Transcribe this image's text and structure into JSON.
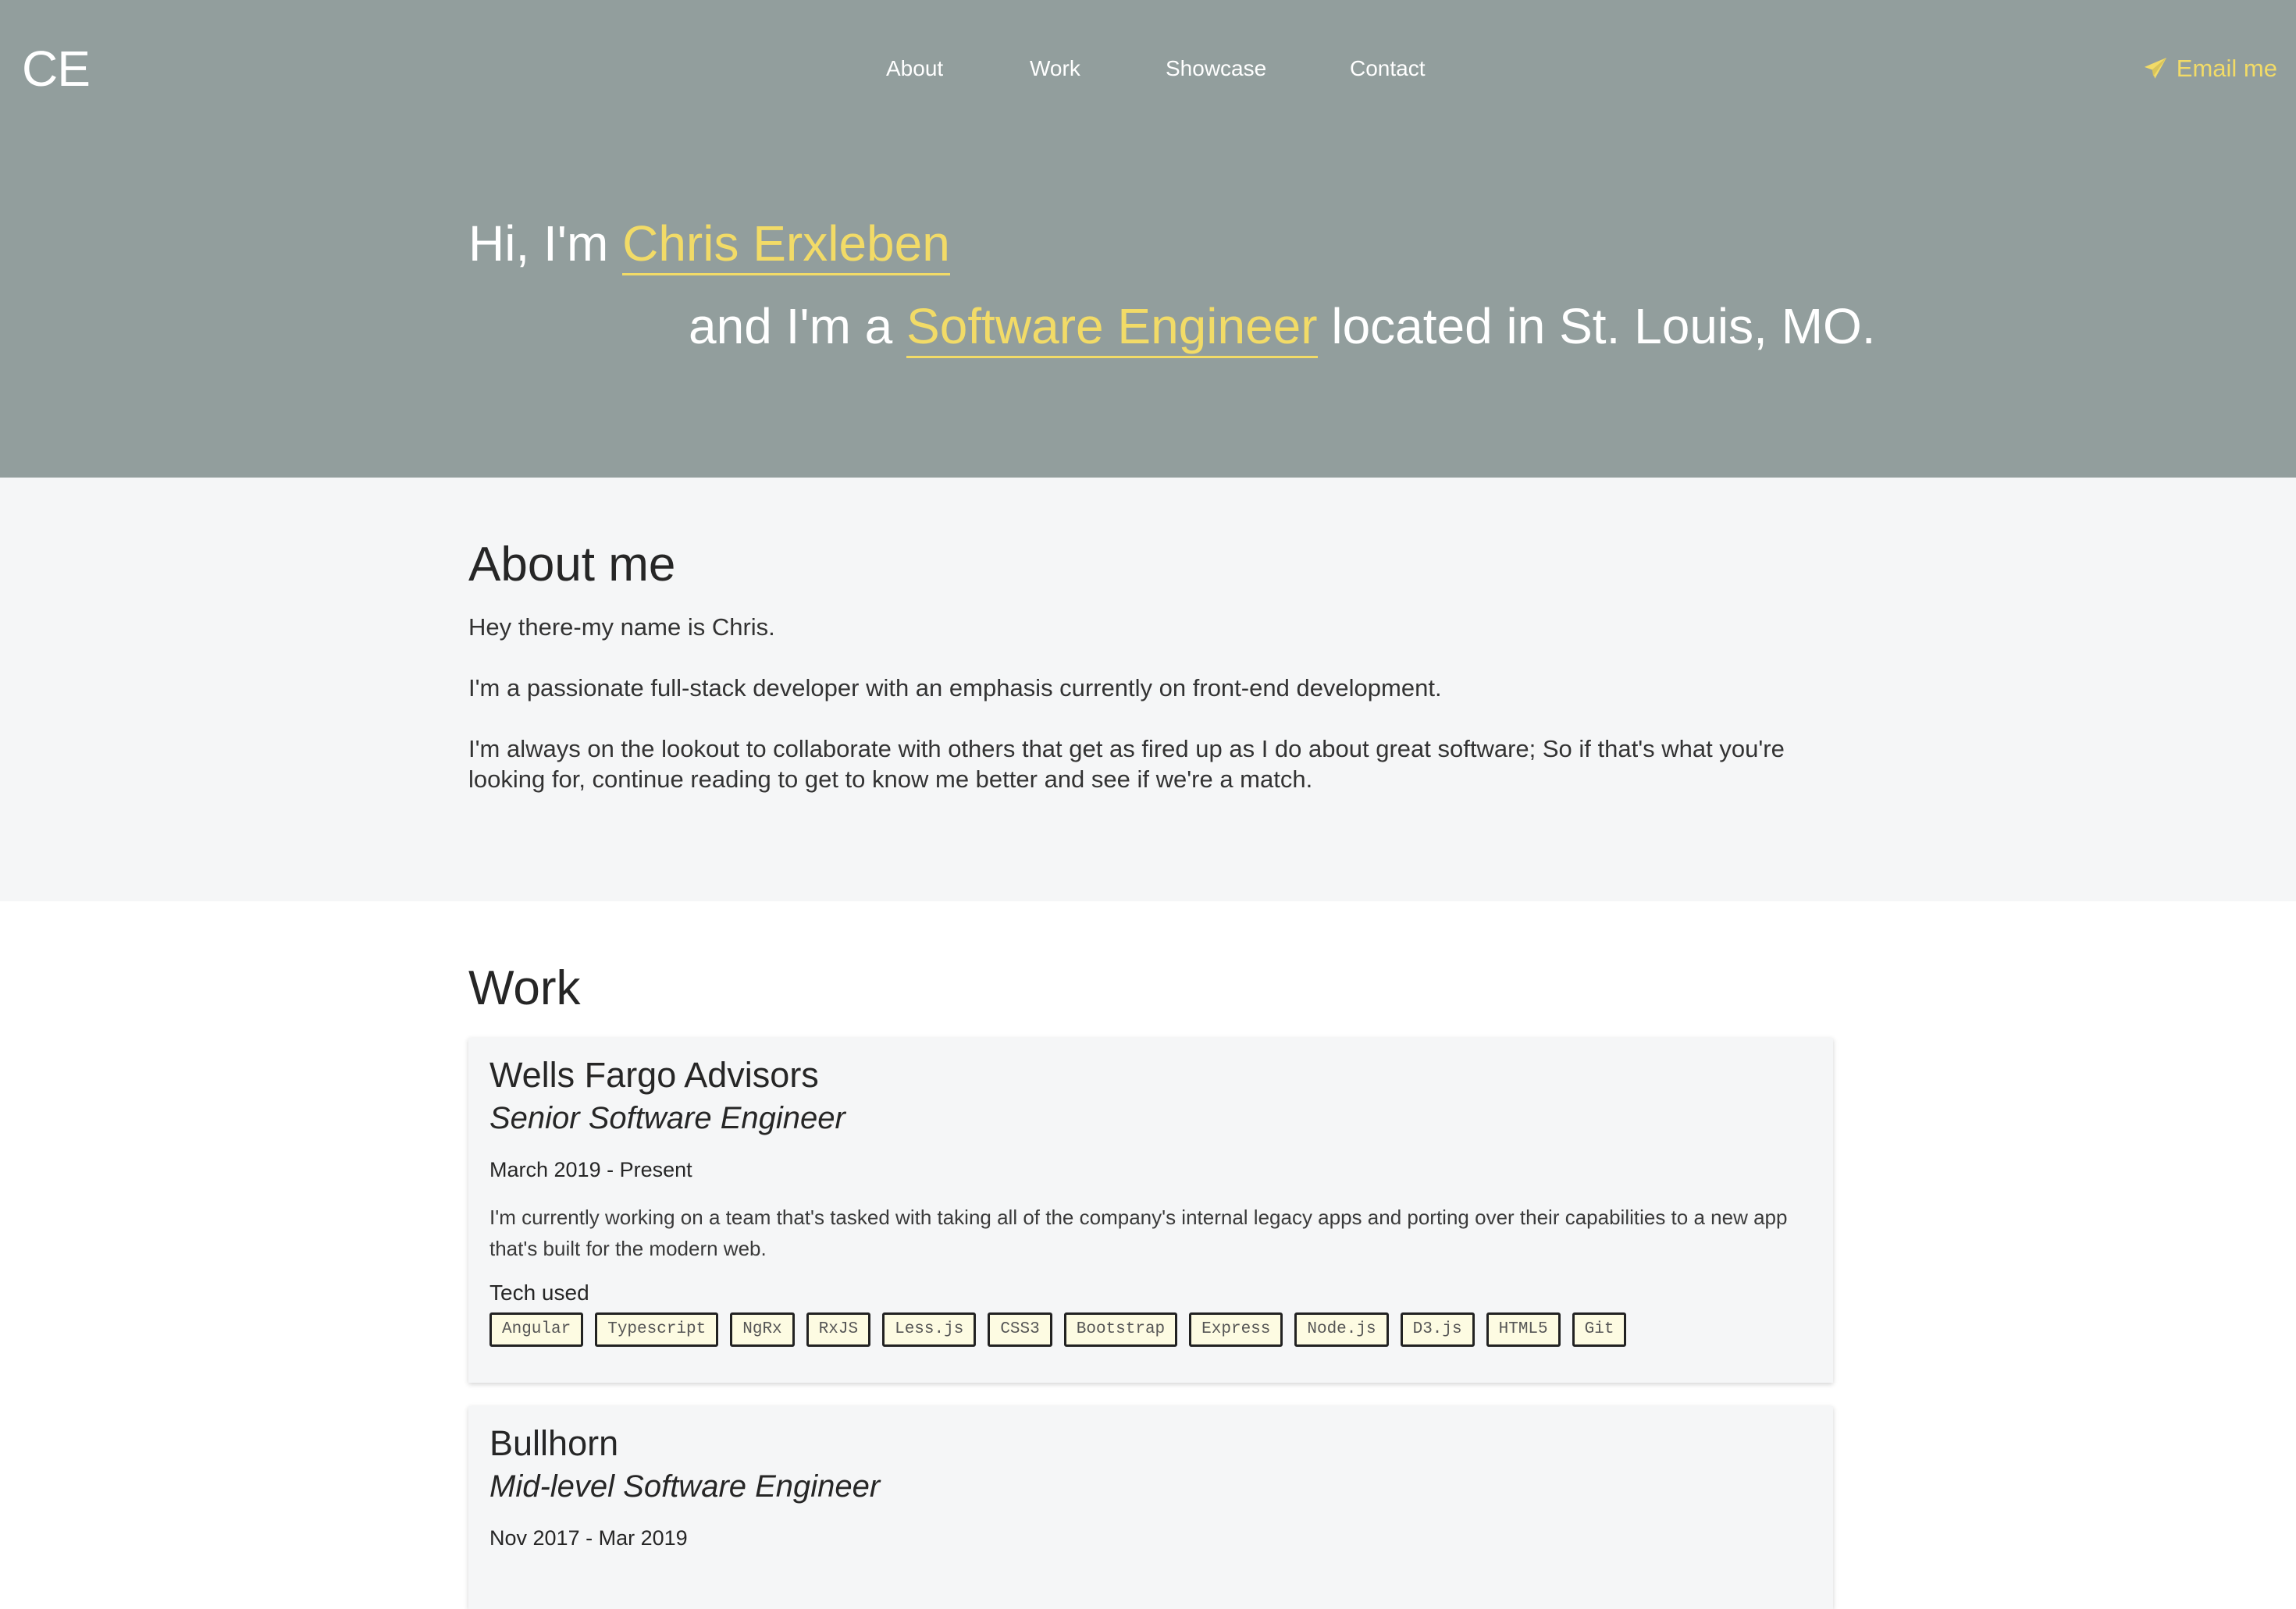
{
  "header": {
    "logo": "CE",
    "nav": [
      "About",
      "Work",
      "Showcase",
      "Contact"
    ],
    "email_label": "Email me",
    "email_icon": "paper-plane-icon"
  },
  "hero": {
    "greeting": "Hi, I'm ",
    "name": "Chris Erxleben",
    "line2_prefix": "and I'm a ",
    "title": "Software Engineer",
    "line2_suffix": " located in St. Louis, MO."
  },
  "about": {
    "heading": "About me",
    "paragraphs": [
      "Hey there-my name is Chris.",
      "I'm a passionate full-stack developer with an emphasis currently on front-end development.",
      "I'm always on the lookout to collaborate with others that get as fired up as I do about great software; So if that's what you're looking for, continue reading to get to know me better and see if we're a match."
    ]
  },
  "work": {
    "heading": "Work",
    "tech_label": "Tech used",
    "jobs": [
      {
        "company": "Wells Fargo Advisors",
        "role": "Senior Software Engineer",
        "dates": "March 2019 - Present",
        "description": "I'm currently working on a team that's tasked with taking all of the company's internal legacy apps and porting over their capabilities to a new app that's built for the modern web.",
        "tech": [
          "Angular",
          "Typescript",
          "NgRx",
          "RxJS",
          "Less.js",
          "CSS3",
          "Bootstrap",
          "Express",
          "Node.js",
          "D3.js",
          "HTML5",
          "Git"
        ]
      },
      {
        "company": "Bullhorn",
        "role": "Mid-level Software Engineer",
        "dates": "Nov 2017 - Mar 2019"
      }
    ]
  },
  "colors": {
    "hero_bg": "#929e9d",
    "accent": "#f2db67",
    "section_alt_bg": "#f5f6f7",
    "tag_bg": "#fdfbe2"
  }
}
